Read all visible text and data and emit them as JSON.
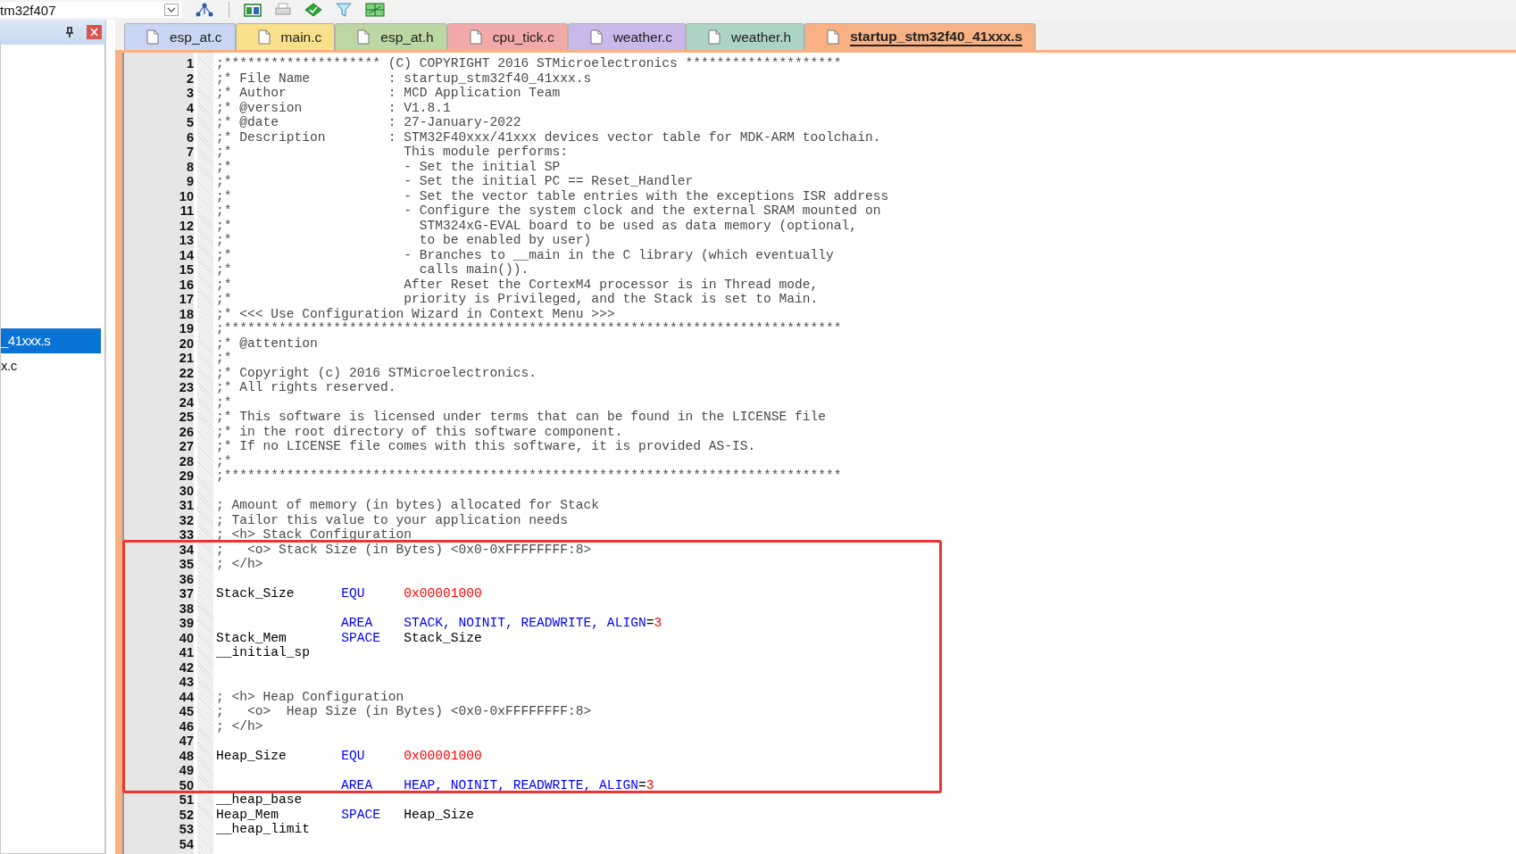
{
  "toolbar": {
    "target": "tm32f407"
  },
  "tabs": [
    {
      "label": "esp_at.c",
      "color": "#c9d5f2",
      "selected": false
    },
    {
      "label": "main.c",
      "color": "#f9e08c",
      "selected": false
    },
    {
      "label": "esp_at.h",
      "color": "#bcd6a4",
      "selected": false
    },
    {
      "label": "cpu_tick.c",
      "color": "#f2a9a9",
      "selected": false
    },
    {
      "label": "weather.c",
      "color": "#cbb8ea",
      "selected": false
    },
    {
      "label": "weather.h",
      "color": "#acd3c4",
      "selected": false
    },
    {
      "label": "startup_stm32f40_41xxx.s",
      "color": "#f8b182",
      "selected": true
    }
  ],
  "sidebar": {
    "items": [
      {
        "label": "_41xxx.s",
        "selected": true
      },
      {
        "label": "x.c",
        "selected": false
      }
    ]
  },
  "editor": {
    "lines": [
      {
        "n": "1",
        "parts": [
          {
            "kind": "comment",
            "text": ";******************** (C) COPYRIGHT 2016 STMicroelectronics ********************"
          }
        ]
      },
      {
        "n": "2",
        "parts": [
          {
            "kind": "comment",
            "text": ";* File Name          : startup_stm32f40_41xxx.s"
          }
        ]
      },
      {
        "n": "3",
        "parts": [
          {
            "kind": "comment",
            "text": ";* Author             : MCD Application Team"
          }
        ]
      },
      {
        "n": "4",
        "parts": [
          {
            "kind": "comment",
            "text": ";* @version           : V1.8.1"
          }
        ]
      },
      {
        "n": "5",
        "parts": [
          {
            "kind": "comment",
            "text": ";* @date              : 27-January-2022"
          }
        ]
      },
      {
        "n": "6",
        "parts": [
          {
            "kind": "comment",
            "text": ";* Description        : STM32F40xxx/41xxx devices vector table for MDK-ARM toolchain."
          }
        ]
      },
      {
        "n": "7",
        "parts": [
          {
            "kind": "comment",
            "text": ";*                      This module performs:"
          }
        ]
      },
      {
        "n": "8",
        "parts": [
          {
            "kind": "comment",
            "text": ";*                      - Set the initial SP"
          }
        ]
      },
      {
        "n": "9",
        "parts": [
          {
            "kind": "comment",
            "text": ";*                      - Set the initial PC == Reset_Handler"
          }
        ]
      },
      {
        "n": "10",
        "parts": [
          {
            "kind": "comment",
            "text": ";*                      - Set the vector table entries with the exceptions ISR address"
          }
        ]
      },
      {
        "n": "11",
        "parts": [
          {
            "kind": "comment",
            "text": ";*                      - Configure the system clock and the external SRAM mounted on"
          }
        ]
      },
      {
        "n": "12",
        "parts": [
          {
            "kind": "comment",
            "text": ";*                        STM324xG-EVAL board to be used as data memory (optional,"
          }
        ]
      },
      {
        "n": "13",
        "parts": [
          {
            "kind": "comment",
            "text": ";*                        to be enabled by user)"
          }
        ]
      },
      {
        "n": "14",
        "parts": [
          {
            "kind": "comment",
            "text": ";*                      - Branches to __main in the C library (which eventually"
          }
        ]
      },
      {
        "n": "15",
        "parts": [
          {
            "kind": "comment",
            "text": ";*                        calls main())."
          }
        ]
      },
      {
        "n": "16",
        "parts": [
          {
            "kind": "comment",
            "text": ";*                      After Reset the CortexM4 processor is in Thread mode,"
          }
        ]
      },
      {
        "n": "17",
        "parts": [
          {
            "kind": "comment",
            "text": ";*                      priority is Privileged, and the Stack is set to Main."
          }
        ]
      },
      {
        "n": "18",
        "parts": [
          {
            "kind": "comment",
            "text": ";* <<< Use Configuration Wizard in Context Menu >>>"
          }
        ]
      },
      {
        "n": "19",
        "parts": [
          {
            "kind": "comment",
            "text": ";*******************************************************************************"
          }
        ]
      },
      {
        "n": "20",
        "parts": [
          {
            "kind": "comment",
            "text": ";* @attention"
          }
        ]
      },
      {
        "n": "21",
        "parts": [
          {
            "kind": "comment",
            "text": ";*"
          }
        ]
      },
      {
        "n": "22",
        "parts": [
          {
            "kind": "comment",
            "text": ";* Copyright (c) 2016 STMicroelectronics."
          }
        ]
      },
      {
        "n": "23",
        "parts": [
          {
            "kind": "comment",
            "text": ";* All rights reserved."
          }
        ]
      },
      {
        "n": "24",
        "parts": [
          {
            "kind": "comment",
            "text": ";*"
          }
        ]
      },
      {
        "n": "25",
        "parts": [
          {
            "kind": "comment",
            "text": ";* This software is licensed under terms that can be found in the LICENSE file"
          }
        ]
      },
      {
        "n": "26",
        "parts": [
          {
            "kind": "comment",
            "text": ";* in the root directory of this software component."
          }
        ]
      },
      {
        "n": "27",
        "parts": [
          {
            "kind": "comment",
            "text": ";* If no LICENSE file comes with this software, it is provided AS-IS."
          }
        ]
      },
      {
        "n": "28",
        "parts": [
          {
            "kind": "comment",
            "text": ";*"
          }
        ]
      },
      {
        "n": "29",
        "parts": [
          {
            "kind": "comment",
            "text": ";*******************************************************************************"
          }
        ]
      },
      {
        "n": "30"
      },
      {
        "n": "31",
        "parts": [
          {
            "kind": "comment",
            "text": "; Amount of memory (in bytes) allocated for Stack"
          }
        ]
      },
      {
        "n": "32",
        "parts": [
          {
            "kind": "comment",
            "text": "; Tailor this value to your application needs"
          }
        ]
      },
      {
        "n": "33",
        "parts": [
          {
            "kind": "comment",
            "text": "; <h> Stack Configuration"
          }
        ]
      },
      {
        "n": "34",
        "parts": [
          {
            "kind": "comment",
            "text": ";   <o> Stack Size (in Bytes) <0x0-0xFFFFFFFF:8>"
          }
        ]
      },
      {
        "n": "35",
        "parts": [
          {
            "kind": "comment",
            "text": "; </h>"
          }
        ]
      },
      {
        "n": "36"
      },
      {
        "n": "37",
        "parts": [
          {
            "kind": "plain",
            "text": "Stack_Size      "
          },
          {
            "kind": "keyword",
            "text": "EQU     "
          },
          {
            "kind": "number",
            "text": "0x00001000"
          }
        ]
      },
      {
        "n": "38"
      },
      {
        "n": "39",
        "parts": [
          {
            "kind": "keyword",
            "text": "AREA    STACK, NOINIT, READWRITE, ALIGN"
          },
          {
            "kind": "plain",
            "text": "="
          },
          {
            "kind": "number",
            "text": "3"
          }
        ]
      },
      {
        "n": "40",
        "parts": [
          {
            "kind": "plain",
            "text": "Stack_Mem       "
          },
          {
            "kind": "keyword",
            "text": "SPACE   "
          },
          {
            "kind": "plain",
            "text": "Stack_Size"
          }
        ]
      },
      {
        "n": "41",
        "parts": [
          {
            "kind": "plain",
            "text": "__initial_sp"
          }
        ]
      },
      {
        "n": "42"
      },
      {
        "n": "43"
      },
      {
        "n": "44",
        "parts": [
          {
            "kind": "comment",
            "text": "; <h> Heap Configuration"
          }
        ]
      },
      {
        "n": "45",
        "parts": [
          {
            "kind": "comment",
            "text": ";   <o>  Heap Size (in Bytes) <0x0-0xFFFFFFFF:8>"
          }
        ]
      },
      {
        "n": "46",
        "parts": [
          {
            "kind": "comment",
            "text": "; </h>"
          }
        ]
      },
      {
        "n": "47"
      },
      {
        "n": "48",
        "parts": [
          {
            "kind": "plain",
            "text": "Heap_Size       "
          },
          {
            "kind": "keyword",
            "text": "EQU     "
          },
          {
            "kind": "number",
            "text": "0x00001000"
          }
        ]
      },
      {
        "n": "49"
      },
      {
        "n": "50",
        "parts": [
          {
            "kind": "keyword",
            "text": "AREA    HEAP, NOINIT, READWRITE, ALIGN"
          },
          {
            "kind": "plain",
            "text": "="
          },
          {
            "kind": "number",
            "text": "3"
          }
        ]
      },
      {
        "n": "51",
        "parts": [
          {
            "kind": "plain",
            "text": "__heap_base"
          }
        ]
      },
      {
        "n": "52",
        "parts": [
          {
            "kind": "plain",
            "text": "Heap_Mem        "
          },
          {
            "kind": "keyword",
            "text": "SPACE   "
          },
          {
            "kind": "plain",
            "text": "Heap_Size"
          }
        ]
      },
      {
        "n": "53",
        "parts": [
          {
            "kind": "plain",
            "text": "__heap_limit"
          }
        ]
      },
      {
        "n": "54"
      }
    ]
  }
}
